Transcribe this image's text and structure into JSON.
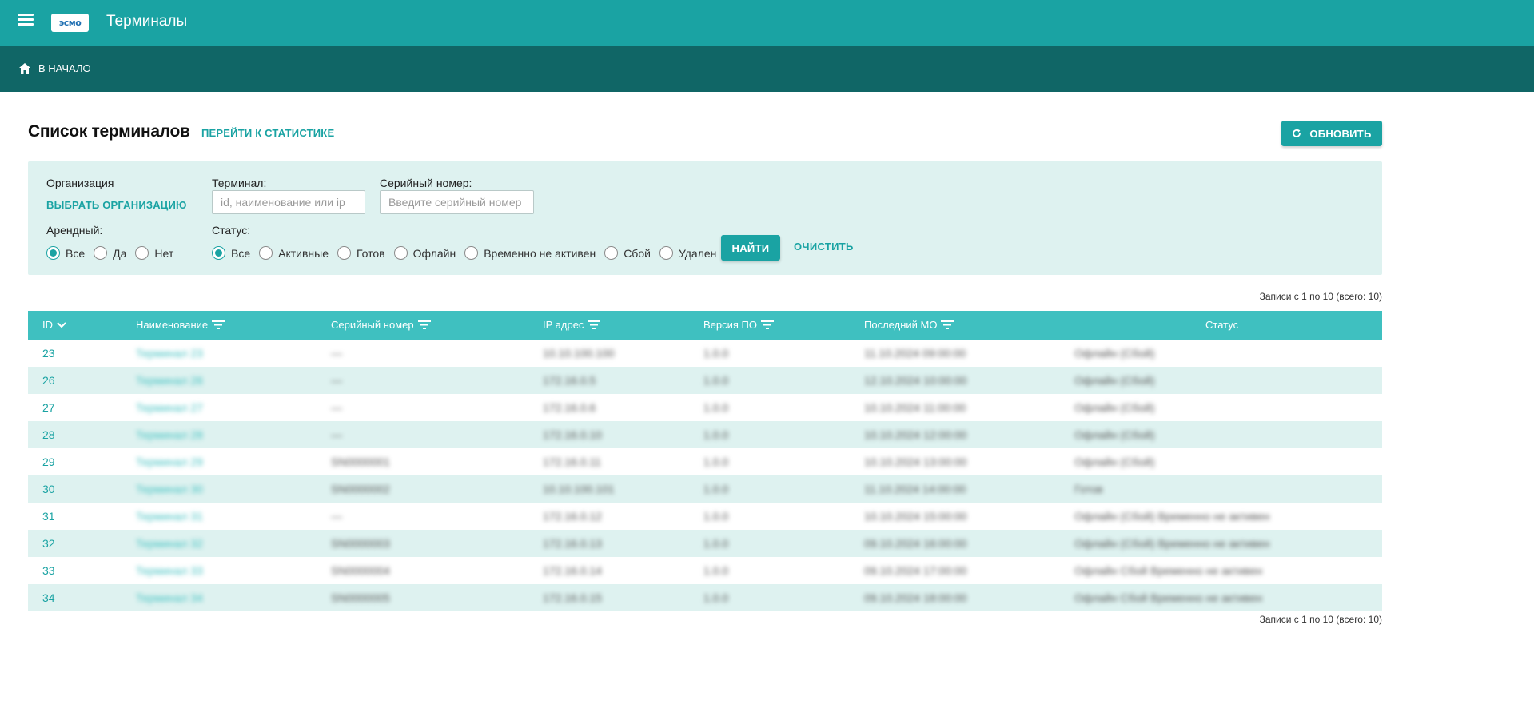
{
  "header": {
    "title": "Терминалы",
    "logo_text": "эсмо"
  },
  "breadcrumb": {
    "home_label": "В НАЧАЛО"
  },
  "page": {
    "title": "Список терминалов",
    "stats_link": "ПЕРЕЙТИ К СТАТИСТИКЕ",
    "refresh_label": "ОБНОВИТЬ"
  },
  "filters": {
    "org_label": "Организация",
    "org_link": "ВЫБРАТЬ ОРГАНИЗАЦИЮ",
    "terminal_label": "Терминал:",
    "terminal_placeholder": "id, наименование или ip",
    "serial_label": "Серийный номер:",
    "serial_placeholder": "Введите серийный номер",
    "rental_label": "Арендный:",
    "rental_options": [
      "Все",
      "Да",
      "Нет"
    ],
    "rental_selected": "Все",
    "status_label": "Статус:",
    "status_options": [
      "Все",
      "Активные",
      "Готов",
      "Офлайн",
      "Временно не активен",
      "Сбой",
      "Удален"
    ],
    "status_selected": "Все",
    "find_label": "НАЙТИ",
    "clear_label": "ОЧИСТИТЬ"
  },
  "records_text": "Записи с 1 по 10 (всего: 10)",
  "table": {
    "columns": [
      "ID",
      "Наименование",
      "Серийный номер",
      "IP адрес",
      "Версия ПО",
      "Последний МО",
      "Статус"
    ],
    "rows": [
      {
        "id": "23",
        "name": "Терминал 23",
        "serial": "—",
        "ip": "10.10.100.100",
        "version": "1.0.0",
        "last_mo": "11.10.2024 09:00:00",
        "status": "Офлайн (Сбой)"
      },
      {
        "id": "26",
        "name": "Терминал 26",
        "serial": "—",
        "ip": "172.16.0.5",
        "version": "1.0.0",
        "last_mo": "12.10.2024 10:00:00",
        "status": "Офлайн (Сбой)"
      },
      {
        "id": "27",
        "name": "Терминал 27",
        "serial": "—",
        "ip": "172.16.0.6",
        "version": "1.0.0",
        "last_mo": "10.10.2024 11:00:00",
        "status": "Офлайн (Сбой)"
      },
      {
        "id": "28",
        "name": "Терминал 28",
        "serial": "—",
        "ip": "172.16.0.10",
        "version": "1.0.0",
        "last_mo": "10.10.2024 12:00:00",
        "status": "Офлайн (Сбой)"
      },
      {
        "id": "29",
        "name": "Терминал 29",
        "serial": "SN0000001",
        "ip": "172.16.0.11",
        "version": "1.0.0",
        "last_mo": "10.10.2024 13:00:00",
        "status": "Офлайн (Сбой)"
      },
      {
        "id": "30",
        "name": "Терминал 30",
        "serial": "SN0000002",
        "ip": "10.10.100.101",
        "version": "1.0.0",
        "last_mo": "11.10.2024 14:00:00",
        "status": "Готов"
      },
      {
        "id": "31",
        "name": "Терминал 31",
        "serial": "—",
        "ip": "172.16.0.12",
        "version": "1.0.0",
        "last_mo": "10.10.2024 15:00:00",
        "status": "Офлайн (Сбой) Временно не активен"
      },
      {
        "id": "32",
        "name": "Терминал 32",
        "serial": "SN0000003",
        "ip": "172.16.0.13",
        "version": "1.0.0",
        "last_mo": "09.10.2024 16:00:00",
        "status": "Офлайн (Сбой) Временно не активен"
      },
      {
        "id": "33",
        "name": "Терминал 33",
        "serial": "SN0000004",
        "ip": "172.16.0.14",
        "version": "1.0.0",
        "last_mo": "09.10.2024 17:00:00",
        "status": "Офлайн Сбой Временно не активен"
      },
      {
        "id": "34",
        "name": "Терминал 34",
        "serial": "SN0000005",
        "ip": "172.16.0.15",
        "version": "1.0.0",
        "last_mo": "09.10.2024 18:00:00",
        "status": "Офлайн Сбой Временно не активен"
      }
    ]
  },
  "colors": {
    "primary": "#1aa3a3",
    "dark": "#106666",
    "header_row": "#3fc0c0",
    "alt_row": "#def2f0"
  }
}
